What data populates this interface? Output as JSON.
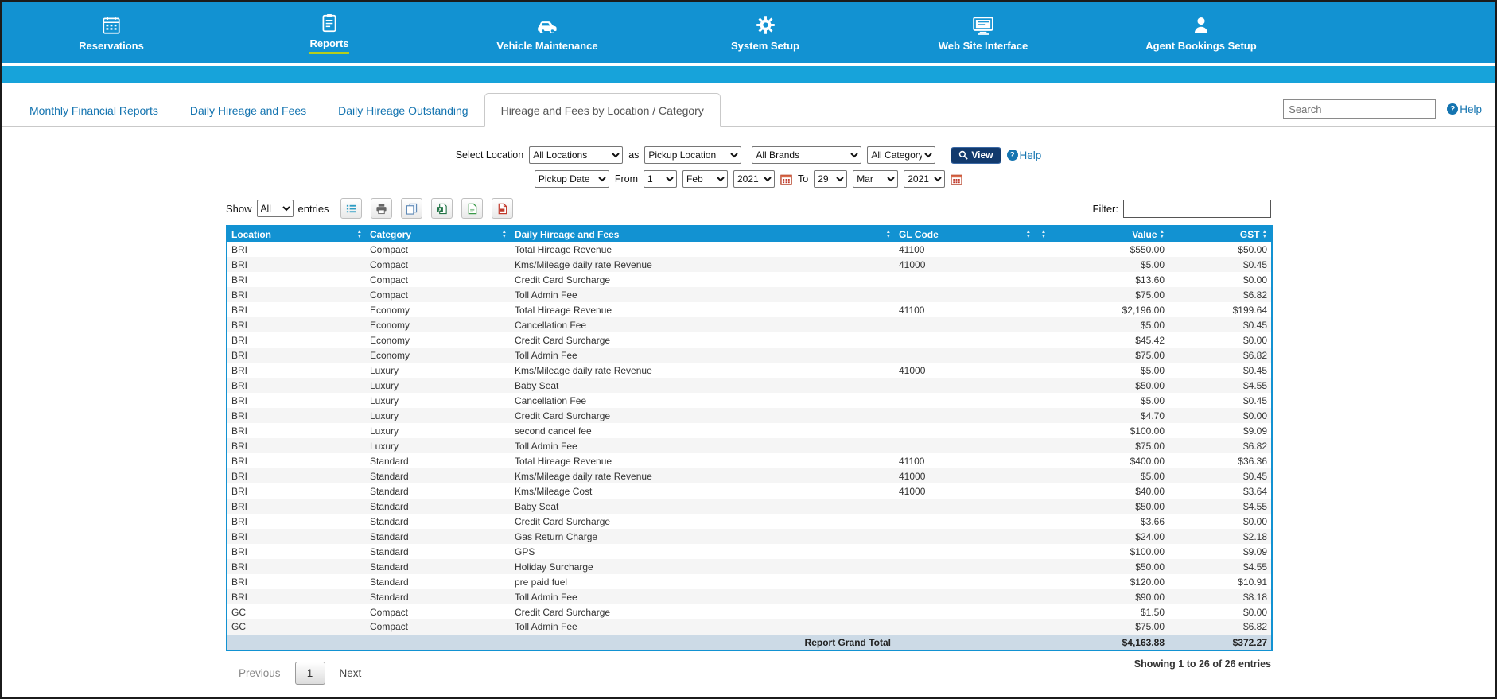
{
  "colors": {
    "nav-blue": "#1292d2",
    "strip-blue": "#17a3da",
    "link-blue": "#1474b0",
    "underline-green": "#b5cd1d",
    "view-btn-bg": "#123a6d",
    "total-row-bg": "#ccdae6"
  },
  "nav": {
    "items": [
      {
        "label": "Reservations",
        "icon": "calendar-grid-icon",
        "active": false
      },
      {
        "label": "Reports",
        "icon": "report-clipboard-icon",
        "active": true
      },
      {
        "label": "Vehicle Maintenance",
        "icon": "car-icon",
        "active": false
      },
      {
        "label": "System Setup",
        "icon": "gear-icon",
        "active": false
      },
      {
        "label": "Web Site Interface",
        "icon": "monitor-icon",
        "active": false
      },
      {
        "label": "Agent Bookings Setup",
        "icon": "person-icon",
        "active": false
      }
    ]
  },
  "tabs": {
    "items": [
      {
        "label": "Monthly Financial Reports",
        "active": false
      },
      {
        "label": "Daily Hireage and Fees",
        "active": false
      },
      {
        "label": "Daily Hireage Outstanding",
        "active": false
      },
      {
        "label": "Hireage and Fees by Location / Category",
        "active": true
      }
    ],
    "search_placeholder": "Search",
    "help_label": "Help"
  },
  "filters": {
    "select_location_label": "Select Location",
    "location_value": "All Locations",
    "as_label": "as",
    "location_type_value": "Pickup Location",
    "brands_value": "All Brands",
    "category_value": "All Category",
    "view_button_label": "View",
    "help_label": "Help",
    "date_type_value": "Pickup Date",
    "from_label": "From",
    "from_day": "1",
    "from_month": "Feb",
    "from_year": "2021",
    "to_label": "To",
    "to_day": "29",
    "to_month": "Mar",
    "to_year": "2021"
  },
  "table_controls": {
    "show_label": "Show",
    "show_value": "All",
    "entries_label": "entries",
    "filter_label": "Filter:"
  },
  "table": {
    "columns": [
      "Location",
      "Category",
      "Daily Hireage and Fees",
      "GL Code",
      "",
      "Value",
      "GST"
    ],
    "rows": [
      [
        "BRI",
        "Compact",
        "Total Hireage Revenue",
        "41100",
        "",
        "$550.00",
        "$50.00"
      ],
      [
        "BRI",
        "Compact",
        "Kms/Mileage daily rate Revenue",
        "41000",
        "",
        "$5.00",
        "$0.45"
      ],
      [
        "BRI",
        "Compact",
        "Credit Card Surcharge",
        "",
        "",
        "$13.60",
        "$0.00"
      ],
      [
        "BRI",
        "Compact",
        "Toll Admin Fee",
        "",
        "",
        "$75.00",
        "$6.82"
      ],
      [
        "BRI",
        "Economy",
        "Total Hireage Revenue",
        "41100",
        "",
        "$2,196.00",
        "$199.64"
      ],
      [
        "BRI",
        "Economy",
        "Cancellation Fee",
        "",
        "",
        "$5.00",
        "$0.45"
      ],
      [
        "BRI",
        "Economy",
        "Credit Card Surcharge",
        "",
        "",
        "$45.42",
        "$0.00"
      ],
      [
        "BRI",
        "Economy",
        "Toll Admin Fee",
        "",
        "",
        "$75.00",
        "$6.82"
      ],
      [
        "BRI",
        "Luxury",
        "Kms/Mileage daily rate Revenue",
        "41000",
        "",
        "$5.00",
        "$0.45"
      ],
      [
        "BRI",
        "Luxury",
        "Baby Seat",
        "",
        "",
        "$50.00",
        "$4.55"
      ],
      [
        "BRI",
        "Luxury",
        "Cancellation Fee",
        "",
        "",
        "$5.00",
        "$0.45"
      ],
      [
        "BRI",
        "Luxury",
        "Credit Card Surcharge",
        "",
        "",
        "$4.70",
        "$0.00"
      ],
      [
        "BRI",
        "Luxury",
        "second cancel fee",
        "",
        "",
        "$100.00",
        "$9.09"
      ],
      [
        "BRI",
        "Luxury",
        "Toll Admin Fee",
        "",
        "",
        "$75.00",
        "$6.82"
      ],
      [
        "BRI",
        "Standard",
        "Total Hireage Revenue",
        "41100",
        "",
        "$400.00",
        "$36.36"
      ],
      [
        "BRI",
        "Standard",
        "Kms/Mileage daily rate Revenue",
        "41000",
        "",
        "$5.00",
        "$0.45"
      ],
      [
        "BRI",
        "Standard",
        "Kms/Mileage Cost",
        "41000",
        "",
        "$40.00",
        "$3.64"
      ],
      [
        "BRI",
        "Standard",
        "Baby Seat",
        "",
        "",
        "$50.00",
        "$4.55"
      ],
      [
        "BRI",
        "Standard",
        "Credit Card Surcharge",
        "",
        "",
        "$3.66",
        "$0.00"
      ],
      [
        "BRI",
        "Standard",
        "Gas Return Charge",
        "",
        "",
        "$24.00",
        "$2.18"
      ],
      [
        "BRI",
        "Standard",
        "GPS",
        "",
        "",
        "$100.00",
        "$9.09"
      ],
      [
        "BRI",
        "Standard",
        "Holiday Surcharge",
        "",
        "",
        "$50.00",
        "$4.55"
      ],
      [
        "BRI",
        "Standard",
        "pre paid fuel",
        "",
        "",
        "$120.00",
        "$10.91"
      ],
      [
        "BRI",
        "Standard",
        "Toll Admin Fee",
        "",
        "",
        "$90.00",
        "$8.18"
      ],
      [
        "GC",
        "Compact",
        "Credit Card Surcharge",
        "",
        "",
        "$1.50",
        "$0.00"
      ],
      [
        "GC",
        "Compact",
        "Toll Admin Fee",
        "",
        "",
        "$75.00",
        "$6.82"
      ]
    ],
    "grand_total_label": "Report Grand Total",
    "grand_total_value": "$4,163.88",
    "grand_total_gst": "$372.27"
  },
  "pagination": {
    "previous_label": "Previous",
    "current_page": "1",
    "next_label": "Next",
    "showing_text": "Showing 1 to 26 of 26 entries"
  }
}
